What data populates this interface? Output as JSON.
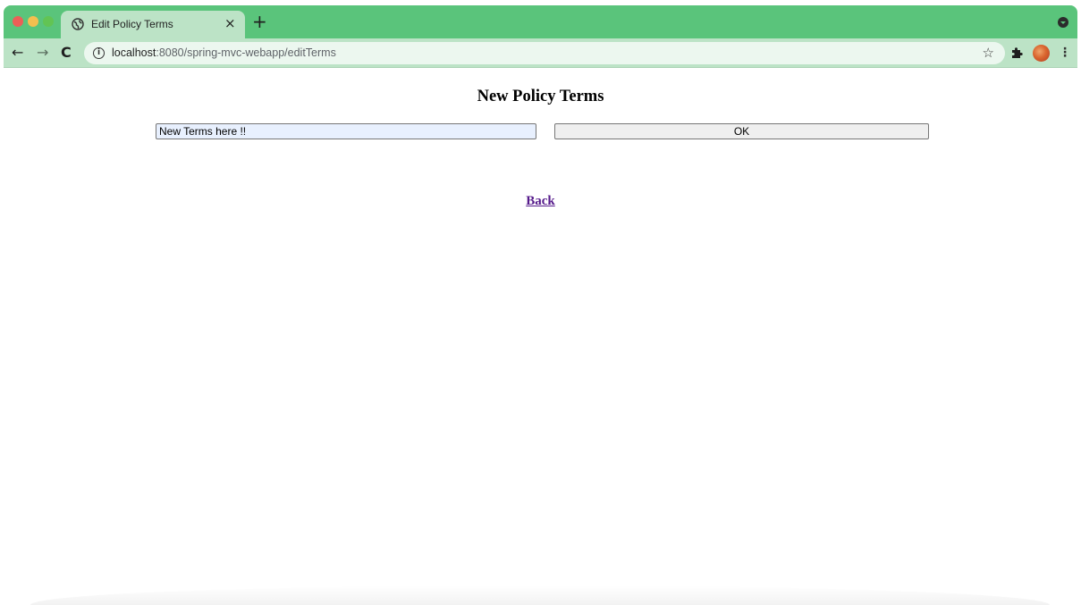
{
  "browser": {
    "tab": {
      "title": "Edit Policy Terms",
      "close_glyph": "×"
    },
    "new_tab_glyph": "+",
    "nav": {
      "back_glyph": "←",
      "forward_glyph": "→",
      "reload_glyph": "C"
    },
    "address_bar": {
      "info_glyph": "i",
      "url_host": "localhost",
      "url_rest": ":8080/spring-mvc-webapp/editTerms"
    },
    "star_glyph": "☆",
    "menu_glyph": "⋮",
    "colors": {
      "tabstrip": "#5ac47b",
      "toolbar": "#bce3c6"
    }
  },
  "page": {
    "heading": "New Policy Terms",
    "terms_input": {
      "value": "New Terms here !!"
    },
    "ok_button_label": "OK",
    "back_link_label": "Back"
  }
}
